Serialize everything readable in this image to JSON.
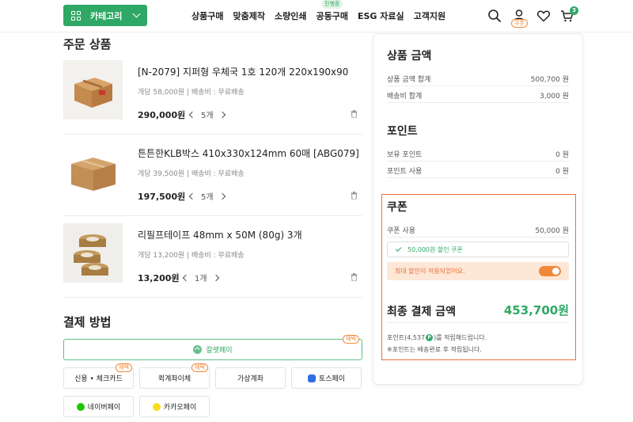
{
  "header": {
    "category_label": "카테고리",
    "nav": [
      {
        "label": "상품구매",
        "badge": ""
      },
      {
        "label": "맞춤제작",
        "badge": ""
      },
      {
        "label": "소량인쇄",
        "badge": ""
      },
      {
        "label": "공동구매",
        "badge": "진행중"
      },
      {
        "label": "ESG 자료실",
        "badge": ""
      },
      {
        "label": "고객지원",
        "badge": ""
      }
    ],
    "coupon_tag": "쿠폰",
    "cart_count": "3",
    "icons": [
      "search-icon",
      "user-icon",
      "heart-icon",
      "cart-icon"
    ],
    "accent_color": "#2fa865"
  },
  "order": {
    "title": "주문 상품",
    "products": [
      {
        "name": "[N-2079] 지퍼형 우체국 1호 120개 220x190x90",
        "meta": "개당 58,000원 | 배송비 : 무료배송",
        "price": "290,000원",
        "qty": "5개"
      },
      {
        "name": "튼튼한KLB박스 410x330x124mm 60매 [ABG079]",
        "meta": "개당 39,500원 | 배송비 : 무료배송",
        "price": "197,500원",
        "qty": "5개"
      },
      {
        "name": "리필프테이프 48mm x 50M (80g) 3개",
        "meta": "개당 13,200원 | 배송비 : 무료배송",
        "price": "13,200원",
        "qty": "1개"
      }
    ]
  },
  "payment": {
    "title": "결제 방법",
    "main_method": "칼렛페이",
    "benefit_badge": "혜택",
    "methods": [
      "신용 • 체크카드",
      "퀵계좌이체",
      "가상계좌",
      "토스페이",
      "네이버페이",
      "카카오페이"
    ]
  },
  "summary": {
    "product_amount_title": "상품 금액",
    "product_total_label": "상품 금액 합계",
    "product_total_value": "500,700 원",
    "shipping_label": "배송비 합계",
    "shipping_value": "3,000 원",
    "points_title": "포인트",
    "owned_points_label": "보유 포인트",
    "owned_points_value": "0 원",
    "use_points_label": "포인트 사용",
    "use_points_value": "0 원",
    "coupon_title": "쿠폰",
    "coupon_use_label": "쿠폰 사용",
    "coupon_use_value": "50,000  원",
    "coupon_chip": "50,000원 할인 쿠폰",
    "max_discount_text": "최대 할인이 적용되었어요.",
    "final_label": "최종 결제 금액",
    "final_value": "453,700원",
    "note1_a": "포인트(4,537",
    "note1_coin": "P",
    "note1_b": ")를 적립해드립니다.",
    "note2": "※포인트는 배송완료 후 적립됩니다."
  }
}
